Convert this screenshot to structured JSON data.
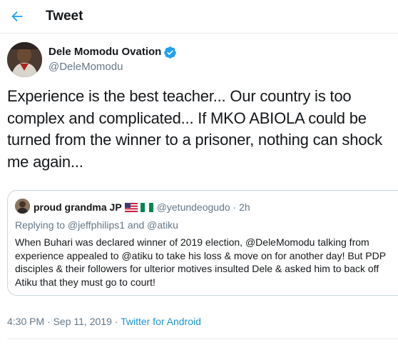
{
  "header": {
    "title": "Tweet",
    "back_icon": "back-arrow-icon"
  },
  "tweet": {
    "display_name": "Dele Momodu Ovation",
    "handle": "@DeleMomodu",
    "verified": true,
    "text": "Experience is the best teacher... Our country is too complex and complicated... If MKO ABIOLA could be turned from the winner to a prisoner, nothing can shock me again...",
    "time": "4:30 PM",
    "date": "Sep 11, 2019",
    "source": "Twitter for Android"
  },
  "quoted": {
    "display_name": "proud grandma JP",
    "flags": [
      "us-flag",
      "nigeria-flag"
    ],
    "handle": "@yetundeogudo",
    "age": "2h",
    "replying_to": "Replying to @jeffphilips1 and @atiku",
    "text": "When Buhari was declared winner of 2019 election, @DeleMomodu talking from experience appealed to @atiku to take his loss & move on for another day! But PDP disciples & their followers for ulterior motives insulted Dele & asked him to back off Atiku that they must go to court!"
  },
  "colors": {
    "accent": "#1da1f2",
    "link": "#1b95e0",
    "secondary_text": "#657786",
    "primary_text": "#14171a",
    "border": "#ccd6dd"
  }
}
